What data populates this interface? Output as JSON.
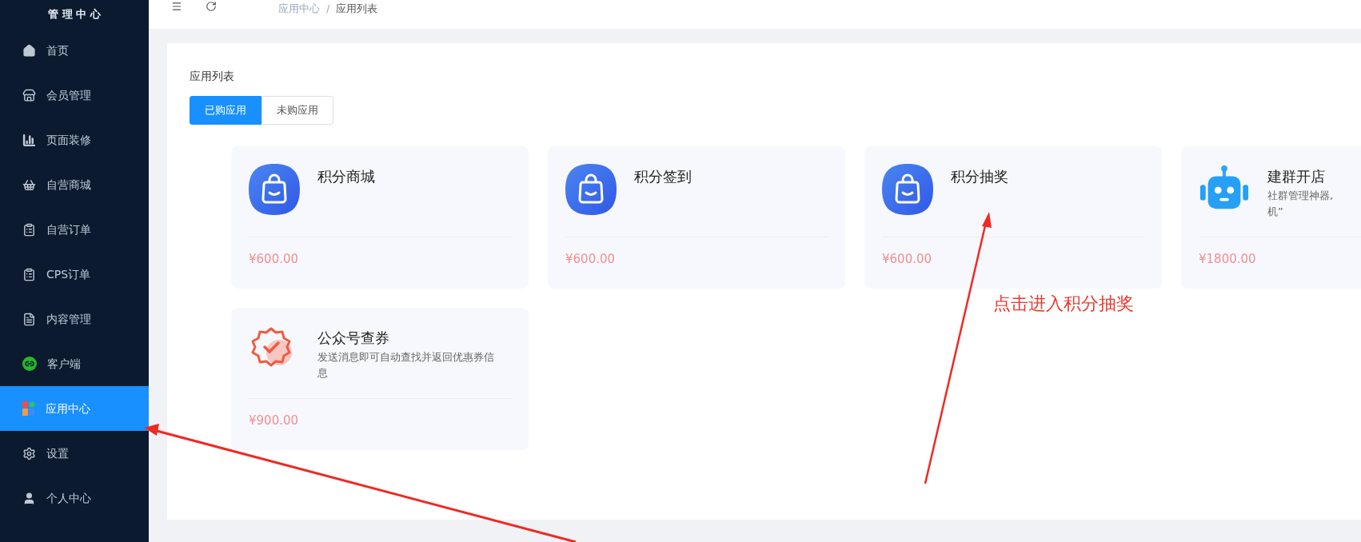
{
  "sidebar": {
    "title": "管 理 中 心",
    "items": [
      {
        "label": "首页",
        "selected": false
      },
      {
        "label": "会员管理",
        "selected": false
      },
      {
        "label": "页面装修",
        "selected": false
      },
      {
        "label": "自营商城",
        "selected": false
      },
      {
        "label": "自营订单",
        "selected": false
      },
      {
        "label": "CPS订单",
        "selected": false
      },
      {
        "label": "内容管理",
        "selected": false
      },
      {
        "label": "客户端",
        "selected": false
      },
      {
        "label": "应用中心",
        "selected": true
      },
      {
        "label": "设置",
        "selected": false
      },
      {
        "label": "个人中心",
        "selected": false
      }
    ]
  },
  "breadcrumb": [
    "应用中心",
    "/",
    "应用列表"
  ],
  "panel": {
    "title": "应用列表",
    "tabs": [
      {
        "label": "已购应用",
        "selected": true
      },
      {
        "label": "未购应用",
        "selected": false
      }
    ],
    "apps": [
      {
        "kind": "bag",
        "name": "积分商城",
        "price": "¥600.00"
      },
      {
        "kind": "bag",
        "name": "积分签到",
        "price": "¥600.00"
      },
      {
        "kind": "bag",
        "name": "积分抽奖",
        "price": "¥600.00"
      },
      {
        "kind": "robot",
        "name": "建群开店",
        "desc": "社群管理神器,\n机”",
        "price": "¥1800.00"
      },
      {
        "kind": "badge",
        "name": "公众号查券",
        "desc": "发送消息即可自动查找并返回优惠券信息",
        "price": "¥900.00"
      }
    ]
  },
  "annotation": {
    "label": "点击进入积分抽奖"
  }
}
